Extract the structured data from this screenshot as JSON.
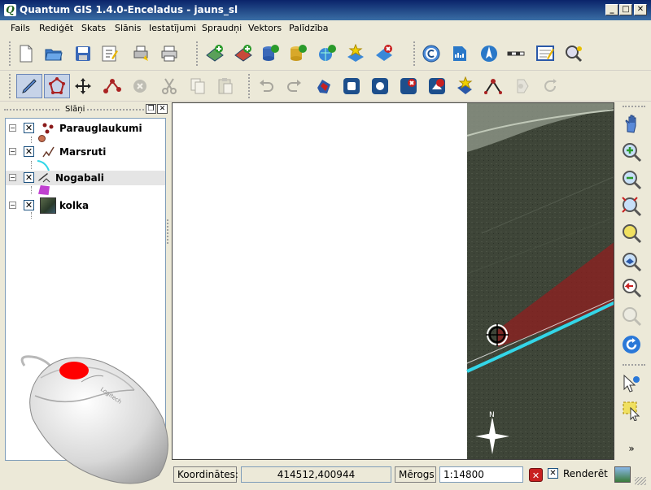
{
  "window": {
    "title": "Quantum GIS 1.4.0-Enceladus - jauns_sl",
    "app_icon": "Q",
    "controls": {
      "minimize": "_",
      "maximize": "□",
      "close": "✕"
    }
  },
  "menu": [
    "Fails",
    "Rediģēt",
    "Skats",
    "Slānis",
    "Iestatījumi",
    "Spraudņi",
    "Vektors",
    "Palīdzība"
  ],
  "toolbar_top": [
    "new-project-icon",
    "open-project-icon",
    "save-project-icon",
    "save-as-icon",
    "print-composer-icon",
    "print-icon",
    "add-vector-layer-icon",
    "add-raster-layer-icon",
    "add-postgis-layer-icon",
    "add-spatialite-layer-icon",
    "add-wms-layer-icon",
    "new-vector-layer-icon",
    "remove-layer-icon",
    "copyright-icon",
    "scalebar-plugin-icon",
    "north-arrow-icon",
    "scale-bar-icon",
    "annotation-icon",
    "identify-icon"
  ],
  "toolbar_edit": [
    "toggle-editing-icon",
    "capture-polygon-icon",
    "move-feature-icon",
    "node-tool-icon",
    "delete-selected-icon",
    "cut-features-icon",
    "copy-features-icon",
    "paste-features-icon",
    "undo-icon",
    "redo-icon",
    "simplify-feature-icon",
    "add-ring-icon",
    "add-island-icon",
    "delete-ring-icon",
    "delete-part-icon",
    "reshape-features-icon",
    "split-features-icon",
    "merge-features-icon",
    "rotate-symbols-icon"
  ],
  "layers_panel": {
    "title": "Slāņi",
    "layers": [
      {
        "name": "Parauglaukumi",
        "checked": "✕",
        "expander": "−",
        "icon": "point-layer-icon"
      },
      {
        "name": "Marsruti",
        "checked": "✕",
        "expander": "−",
        "icon": "line-layer-icon"
      },
      {
        "name": "Nogabali",
        "checked": "✕",
        "expander": "−",
        "icon": "polygon-layer-icon"
      },
      {
        "name": "kolka",
        "checked": "✕",
        "expander": "−",
        "icon": "raster-layer-icon"
      }
    ]
  },
  "map_tools": [
    "pan-icon",
    "zoom-in-icon",
    "zoom-out-icon",
    "zoom-full-icon",
    "zoom-to-selection-icon",
    "zoom-to-layer-icon",
    "zoom-last-icon",
    "zoom-next-icon",
    "refresh-icon",
    "identify-features-icon",
    "select-features-icon",
    "more-tools-icon"
  ],
  "statusbar": {
    "coordinates_label": "Koordinātes:",
    "coordinates_value": "414512,400944",
    "scale_label": "Mērogs",
    "scale_value": "1:14800",
    "render_label": "Renderēt",
    "render_checked": "✕",
    "stop_icon": "✕"
  },
  "map": {
    "north_label": "N"
  },
  "colors": {
    "titlebar": "#0a246a",
    "selection": "#e5e5e5",
    "polygon_fill": "#8b2020",
    "route_line": "#33d6e8",
    "mouse_button": "#ff0000"
  }
}
